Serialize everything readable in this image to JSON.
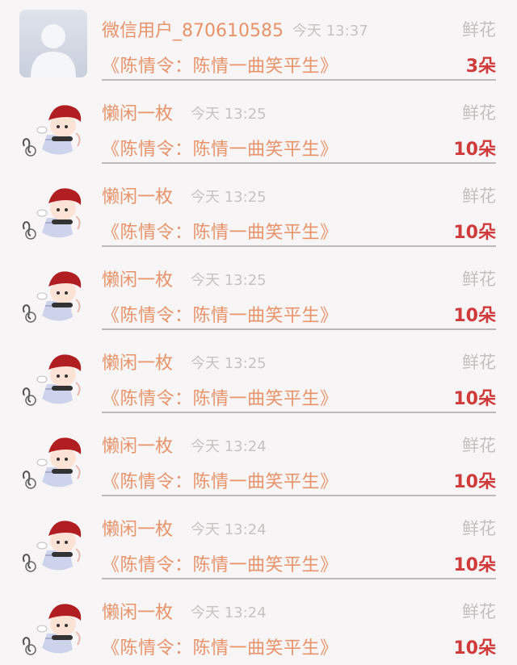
{
  "gift_label": "鲜花",
  "work_title": "《陈情令：陈情一曲笑平生》",
  "records": [
    {
      "user": "微信用户_870610585",
      "time": "今天 13:37",
      "count": "3朵",
      "avatar": "default-avatar"
    },
    {
      "user": "懒闲一枚",
      "time": "今天 13:25",
      "count": "10朵",
      "avatar": "cartoon-avatar"
    },
    {
      "user": "懒闲一枚",
      "time": "今天 13:25",
      "count": "10朵",
      "avatar": "cartoon-avatar"
    },
    {
      "user": "懒闲一枚",
      "time": "今天 13:25",
      "count": "10朵",
      "avatar": "cartoon-avatar"
    },
    {
      "user": "懒闲一枚",
      "time": "今天 13:25",
      "count": "10朵",
      "avatar": "cartoon-avatar"
    },
    {
      "user": "懒闲一枚",
      "time": "今天 13:24",
      "count": "10朵",
      "avatar": "cartoon-avatar"
    },
    {
      "user": "懒闲一枚",
      "time": "今天 13:24",
      "count": "10朵",
      "avatar": "cartoon-avatar"
    },
    {
      "user": "懒闲一枚",
      "time": "今天 13:24",
      "count": "10朵",
      "avatar": "cartoon-avatar"
    }
  ],
  "colors": {
    "accent": "#e8936a",
    "count": "#d03a3a",
    "muted": "#c6c2c2",
    "background": "#f7f5f5"
  }
}
